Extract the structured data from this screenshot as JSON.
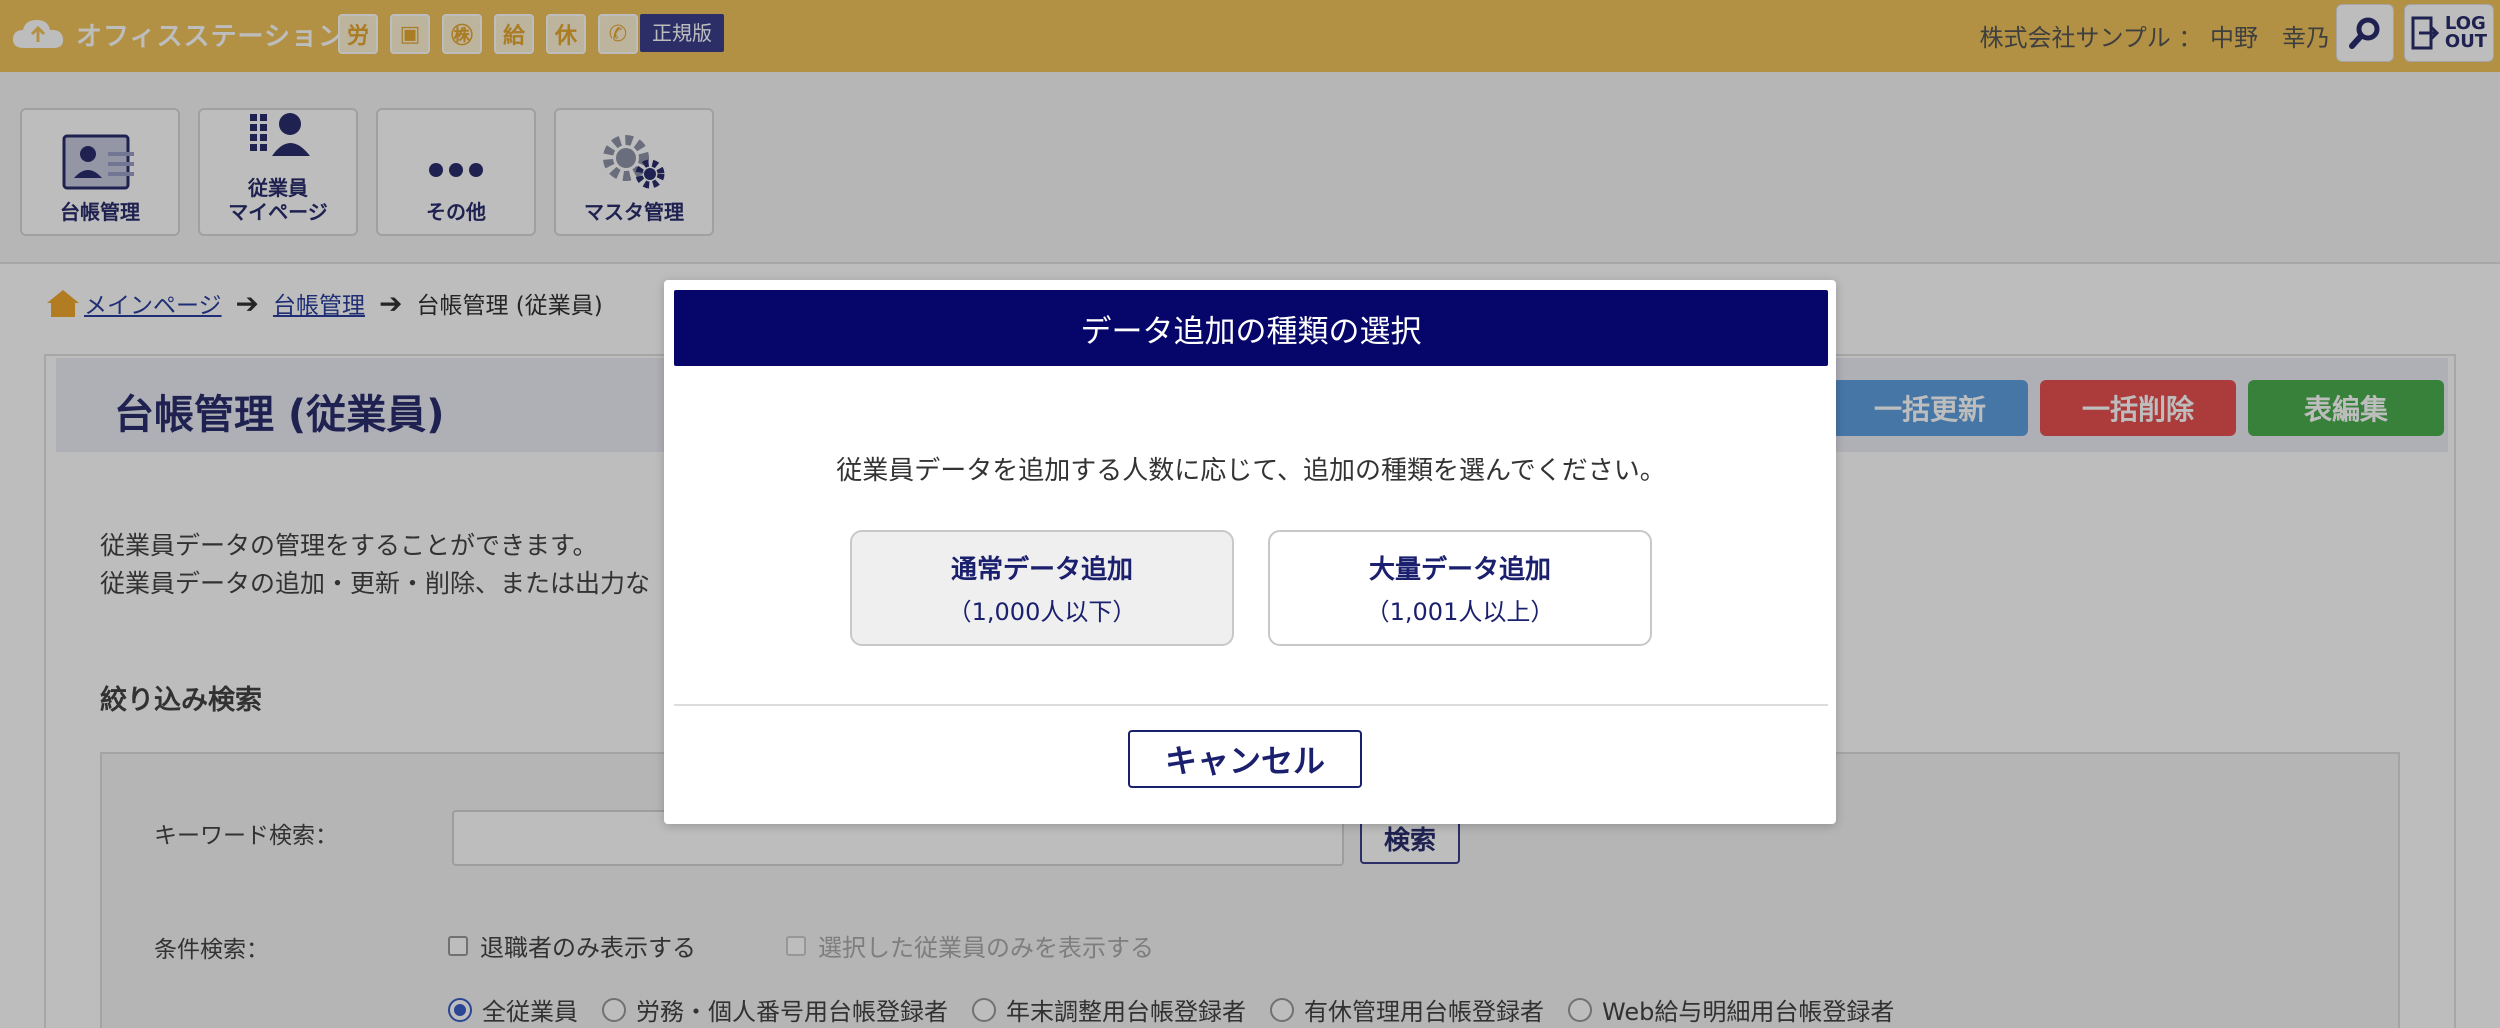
{
  "header": {
    "app_name": "オフィスステーション",
    "icons": [
      {
        "name": "labor-icon",
        "glyph": "労"
      },
      {
        "name": "briefcase-icon",
        "glyph": "▣"
      },
      {
        "name": "stamp-icon",
        "glyph": "㊑"
      },
      {
        "name": "salary-icon",
        "glyph": "給"
      },
      {
        "name": "leave-icon",
        "glyph": "休"
      },
      {
        "name": "phone-icon",
        "glyph": "✆"
      }
    ],
    "edition": "正規版",
    "company_user": "株式会社サンプル ： 中野　幸乃",
    "logout_label_1": "LOG",
    "logout_label_2": "OUT"
  },
  "nav": {
    "tiles": [
      {
        "label_1": "台帳管理",
        "label_2": ""
      },
      {
        "label_1": "従業員",
        "label_2": "マイページ"
      },
      {
        "label_1": "その他",
        "label_2": ""
      },
      {
        "label_1": "マスタ管理",
        "label_2": ""
      }
    ]
  },
  "breadcrumb": {
    "home": "メインページ",
    "level1": "台帳管理",
    "current": "台帳管理 (従業員)"
  },
  "page": {
    "title": "台帳管理 (従業員)",
    "buttons": {
      "bulk_update": "一括更新",
      "bulk_delete": "一括削除",
      "table_edit": "表編集"
    },
    "desc_line1": "従業員データの管理をすることができます。",
    "desc_line2": "従業員データの追加・更新・削除、または出力な",
    "filter_heading": "絞り込み検索",
    "keyword_label": "キーワード検索：",
    "search_button": "検索",
    "condition_label": "条件検索：",
    "checks": {
      "retired_only": "退職者のみ表示する",
      "selected_only": "選択した従業員のみを表示する"
    },
    "radios": [
      "全従業員",
      "労務・個人番号用台帳登録者",
      "年末調整用台帳登録者",
      "有休管理用台帳登録者",
      "Web給与明細用台帳登録者"
    ]
  },
  "modal": {
    "title": "データ追加の種類の選択",
    "message": "従業員データを追加する人数に応じて、追加の種類を選んでください。",
    "normal": {
      "main": "通常データ追加",
      "sub": "（1,000人以下）"
    },
    "bulk": {
      "main": "大量データ追加",
      "sub": "（1,001人以上）"
    },
    "cancel": "キャンセル"
  },
  "colors": {
    "header_bg": "#f0c45c",
    "modal_header": "#06066a",
    "bulk_update": "#5f9fe0",
    "bulk_delete": "#e85050",
    "table_edit": "#4caf50"
  }
}
